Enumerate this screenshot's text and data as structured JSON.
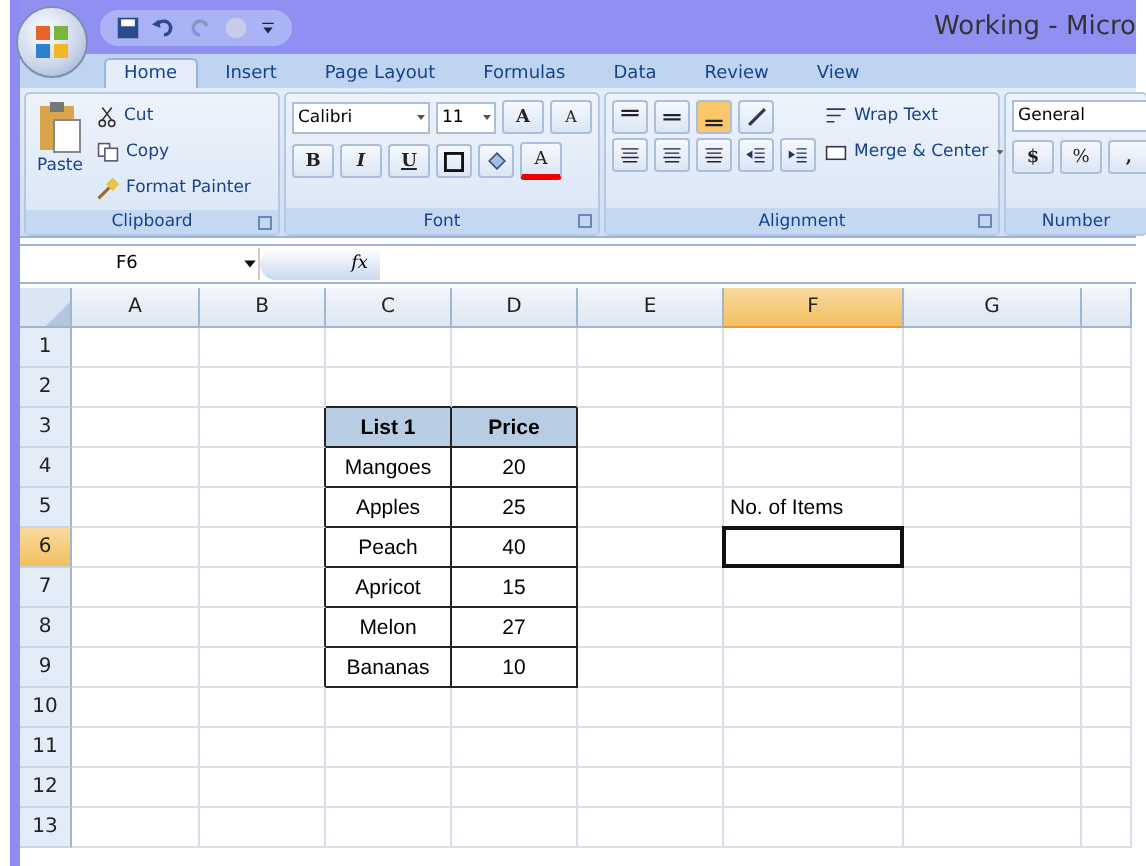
{
  "window": {
    "title": "Working - Micro"
  },
  "tabs": [
    {
      "label": "Home",
      "selected": true
    },
    {
      "label": "Insert",
      "selected": false
    },
    {
      "label": "Page Layout",
      "selected": false
    },
    {
      "label": "Formulas",
      "selected": false
    },
    {
      "label": "Data",
      "selected": false
    },
    {
      "label": "Review",
      "selected": false
    },
    {
      "label": "View",
      "selected": false
    }
  ],
  "clipboard": {
    "title": "Clipboard",
    "paste": "Paste",
    "cut": "Cut",
    "copy": "Copy",
    "format_painter": "Format Painter"
  },
  "font": {
    "title": "Font",
    "name": "Calibri",
    "size": "11",
    "grow": "A",
    "shrink": "A",
    "bold": "B",
    "italic": "I",
    "underline": "U",
    "text_color": "A"
  },
  "alignment": {
    "title": "Alignment",
    "wrap": "Wrap Text",
    "merge": "Merge & Center"
  },
  "number": {
    "title": "Number",
    "format": "General",
    "currency": "$",
    "percent": "%",
    "comma": ","
  },
  "name_box": "F6",
  "formula_label": "fx",
  "columns": [
    {
      "label": "A",
      "selected": false
    },
    {
      "label": "B",
      "selected": false
    },
    {
      "label": "C",
      "selected": false
    },
    {
      "label": "D",
      "selected": false
    },
    {
      "label": "E",
      "selected": false
    },
    {
      "label": "F",
      "selected": true
    },
    {
      "label": "G",
      "selected": false
    }
  ],
  "rows": [
    {
      "number": "1",
      "selected": false,
      "cells": [
        null,
        null,
        null,
        null,
        null,
        null,
        null
      ]
    },
    {
      "number": "2",
      "selected": false,
      "cells": [
        null,
        null,
        null,
        null,
        null,
        null,
        null
      ]
    },
    {
      "number": "3",
      "selected": false,
      "cells": [
        null,
        null,
        {
          "text": "List 1",
          "kind": "header"
        },
        {
          "text": "Price",
          "kind": "header"
        },
        null,
        null,
        null
      ]
    },
    {
      "number": "4",
      "selected": false,
      "cells": [
        null,
        null,
        {
          "text": "Mangoes",
          "kind": "data"
        },
        {
          "text": "20",
          "kind": "data"
        },
        null,
        null,
        null
      ]
    },
    {
      "number": "5",
      "selected": false,
      "cells": [
        null,
        null,
        {
          "text": "Apples",
          "kind": "data"
        },
        {
          "text": "25",
          "kind": "data"
        },
        null,
        {
          "text": "No. of Items",
          "kind": "label"
        },
        null
      ]
    },
    {
      "number": "6",
      "selected": true,
      "cells": [
        null,
        null,
        {
          "text": "Peach",
          "kind": "data"
        },
        {
          "text": "40",
          "kind": "data"
        },
        null,
        null,
        null
      ]
    },
    {
      "number": "7",
      "selected": false,
      "cells": [
        null,
        null,
        {
          "text": "Apricot",
          "kind": "data"
        },
        {
          "text": "15",
          "kind": "data"
        },
        null,
        null,
        null
      ]
    },
    {
      "number": "8",
      "selected": false,
      "cells": [
        null,
        null,
        {
          "text": "Melon",
          "kind": "data"
        },
        {
          "text": "27",
          "kind": "data"
        },
        null,
        null,
        null
      ]
    },
    {
      "number": "9",
      "selected": false,
      "cells": [
        null,
        null,
        {
          "text": "Bananas",
          "kind": "data"
        },
        {
          "text": "10",
          "kind": "data"
        },
        null,
        null,
        null
      ]
    },
    {
      "number": "10",
      "selected": false,
      "cells": [
        null,
        null,
        null,
        null,
        null,
        null,
        null
      ]
    },
    {
      "number": "11",
      "selected": false,
      "cells": [
        null,
        null,
        null,
        null,
        null,
        null,
        null
      ]
    },
    {
      "number": "12",
      "selected": false,
      "cells": [
        null,
        null,
        null,
        null,
        null,
        null,
        null
      ]
    },
    {
      "number": "13",
      "selected": false,
      "cells": [
        null,
        null,
        null,
        null,
        null,
        null,
        null
      ]
    }
  ]
}
